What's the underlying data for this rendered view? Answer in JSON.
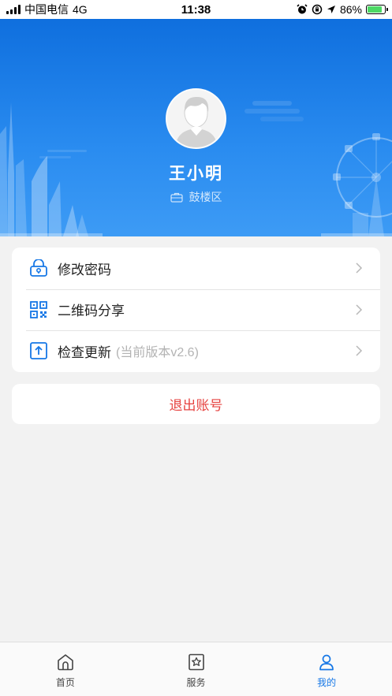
{
  "status_bar": {
    "carrier": "中国电信",
    "network": "4G",
    "time": "11:38",
    "battery_percent": "86%",
    "battery_level": 0.86
  },
  "profile": {
    "name": "王小明",
    "district": "鼓楼区"
  },
  "menu": {
    "items": [
      {
        "label": "修改密码",
        "note": "",
        "icon": "lock-icon"
      },
      {
        "label": "二维码分享",
        "note": "",
        "icon": "qrcode-icon"
      },
      {
        "label": "检查更新",
        "note": "(当前版本v2.6)",
        "icon": "upload-icon"
      }
    ]
  },
  "logout": {
    "label": "退出账号",
    "color": "#e64340"
  },
  "tabbar": {
    "tabs": [
      {
        "label": "首页",
        "icon": "home-icon",
        "active": false
      },
      {
        "label": "服务",
        "icon": "star-badge-icon",
        "active": false
      },
      {
        "label": "我的",
        "icon": "user-icon",
        "active": true
      }
    ],
    "active_color": "#1677e6"
  },
  "colors": {
    "header_top": "#0f6fde",
    "header_bottom": "#3d9bf5",
    "accent": "#1677e6"
  }
}
